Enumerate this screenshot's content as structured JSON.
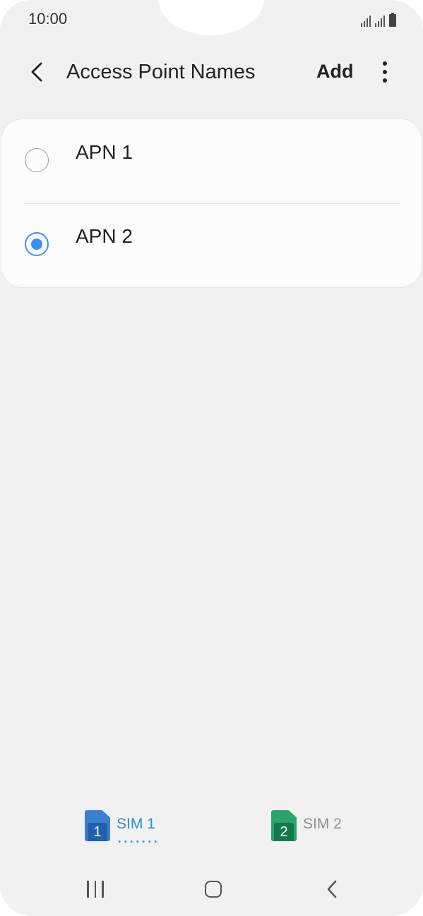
{
  "status_bar": {
    "time": "10:00",
    "icons": [
      "signal-sim1-icon",
      "signal-sim2-icon",
      "battery-icon"
    ]
  },
  "app_bar": {
    "back_icon": "chevron-left-icon",
    "title": "Access Point Names",
    "add_label": "Add",
    "more_icon": "more-vertical-icon"
  },
  "apn_list": {
    "items": [
      {
        "label": "APN 1",
        "selected": false
      },
      {
        "label": "APN 2",
        "selected": true
      }
    ]
  },
  "sim_tabs": {
    "items": [
      {
        "badge": "1",
        "label": "SIM 1",
        "active": true,
        "color": "#3a7fd0"
      },
      {
        "badge": "2",
        "label": "SIM 2",
        "active": false,
        "color": "#2aa46a"
      }
    ]
  },
  "nav_bar": {
    "icons": [
      "recents-icon",
      "home-icon",
      "back-icon"
    ]
  },
  "colors": {
    "accent": "#3e8ef7",
    "sim1_tab_text": "#2a8fd6",
    "background": "#f1f1f1",
    "card": "#fcfcfc"
  }
}
